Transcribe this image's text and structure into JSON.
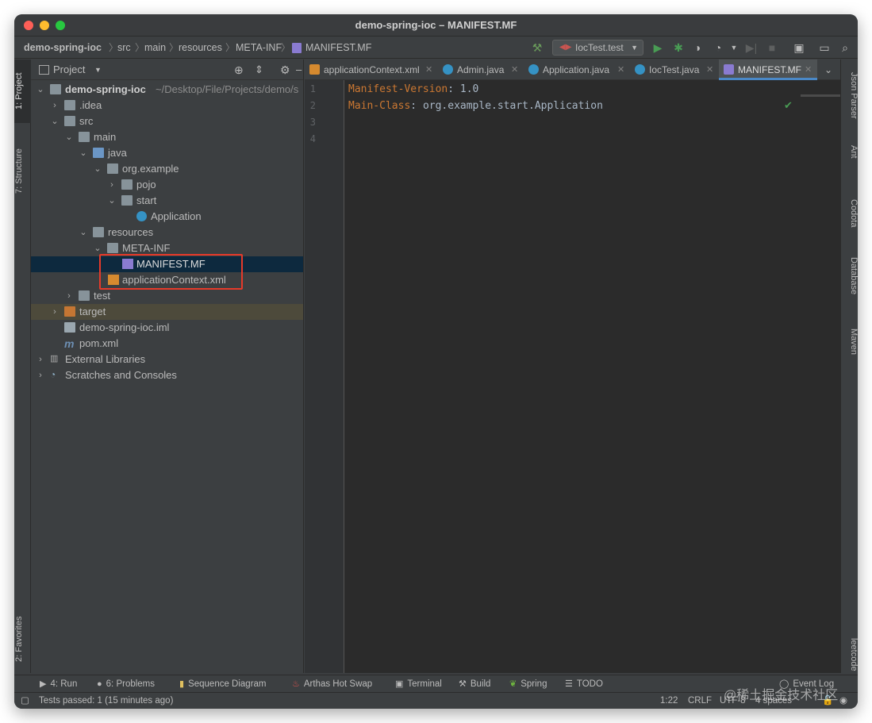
{
  "window": {
    "title": "demo-spring-ioc – MANIFEST.MF"
  },
  "navbar": {
    "breadcrumbs": [
      "demo-spring-ioc",
      "src",
      "main",
      "resources",
      "META-INF",
      "MANIFEST.MF"
    ],
    "run_config": "IocTest.test"
  },
  "left_tabs": {
    "project": "1: Project",
    "structure": "7: Structure",
    "favorites": "2: Favorites"
  },
  "right_tabs": [
    "Json Parser",
    "Ant",
    "Codota",
    "Database",
    "Maven",
    "leetcode"
  ],
  "project_panel": {
    "title": "Project",
    "tree": [
      {
        "label": "demo-spring-ioc",
        "extra": "~/Desktop/File/Projects/demo/s"
      },
      {
        "label": ".idea"
      },
      {
        "label": "src"
      },
      {
        "label": "main"
      },
      {
        "label": "java"
      },
      {
        "label": "org.example"
      },
      {
        "label": "pojo"
      },
      {
        "label": "start"
      },
      {
        "label": "Application"
      },
      {
        "label": "resources"
      },
      {
        "label": "META-INF"
      },
      {
        "label": "MANIFEST.MF"
      },
      {
        "label": "applicationContext.xml"
      },
      {
        "label": "test"
      },
      {
        "label": "target"
      },
      {
        "label": "demo-spring-ioc.iml"
      },
      {
        "label": "pom.xml"
      },
      {
        "label": "External Libraries"
      },
      {
        "label": "Scratches and Consoles"
      }
    ]
  },
  "editor": {
    "tabs": [
      "applicationContext.xml",
      "Admin.java",
      "Application.java",
      "IocTest.java",
      "MANIFEST.MF"
    ],
    "active_tab": "MANIFEST.MF",
    "line_numbers": [
      "1",
      "2",
      "3",
      "4"
    ],
    "lines": [
      {
        "key": "Manifest-Version",
        "sep": ": ",
        "value": "1.0"
      },
      {
        "key": "Main-Class",
        "sep": ": ",
        "value": "org.example.start.Application"
      }
    ]
  },
  "bottom_tools": {
    "run": "4: Run",
    "problems": "6: Problems",
    "sequence": "Sequence Diagram",
    "arthas": "Arthas Hot Swap",
    "terminal": "Terminal",
    "build": "Build",
    "spring": "Spring",
    "todo": "TODO",
    "event_log": "Event Log"
  },
  "status": {
    "message": "Tests passed: 1 (15 minutes ago)",
    "position": "1:22",
    "line_sep": "CRLF",
    "encoding": "UTF-8",
    "indent": "4 spaces"
  },
  "watermark": "@稀土掘金技术社区",
  "colors": {
    "keyword": "#cc7832",
    "text": "#a9b7c6",
    "selection": "#0d293e",
    "highlight_box": "#e63a2a",
    "active_tab_underline": "#4a88c7"
  }
}
